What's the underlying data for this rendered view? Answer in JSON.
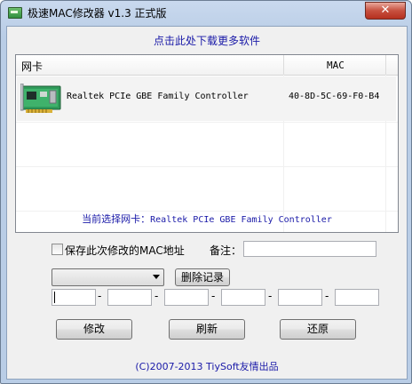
{
  "window": {
    "title": "极速MAC修改器 v1.3 正式版",
    "close_glyph": "✕"
  },
  "download_link": "点击此处下载更多软件",
  "list": {
    "columns": [
      "网卡",
      "MAC"
    ],
    "rows": [
      {
        "name": "Realtek PCIe GBE Family Controller",
        "mac": "40-8D-5C-69-F0-B4"
      }
    ]
  },
  "current": {
    "label": "当前选择网卡：",
    "value": "Realtek PCIe GBE Family Controller"
  },
  "save_checkbox": {
    "label": "保存此次修改的MAC地址",
    "checked": false
  },
  "note": {
    "label": "备注：",
    "value": ""
  },
  "history_combo": {
    "value": ""
  },
  "buttons": {
    "delete": "删除记录",
    "modify": "修改",
    "refresh": "刷新",
    "restore": "还原"
  },
  "mac_fields": [
    "",
    "",
    "",
    "",
    "",
    ""
  ],
  "separator": "-",
  "footer": "(C)2007-2013 TiySoft友情出品",
  "icons": {
    "app": "app-icon",
    "nic": "network-card-icon",
    "close": "close-icon"
  }
}
